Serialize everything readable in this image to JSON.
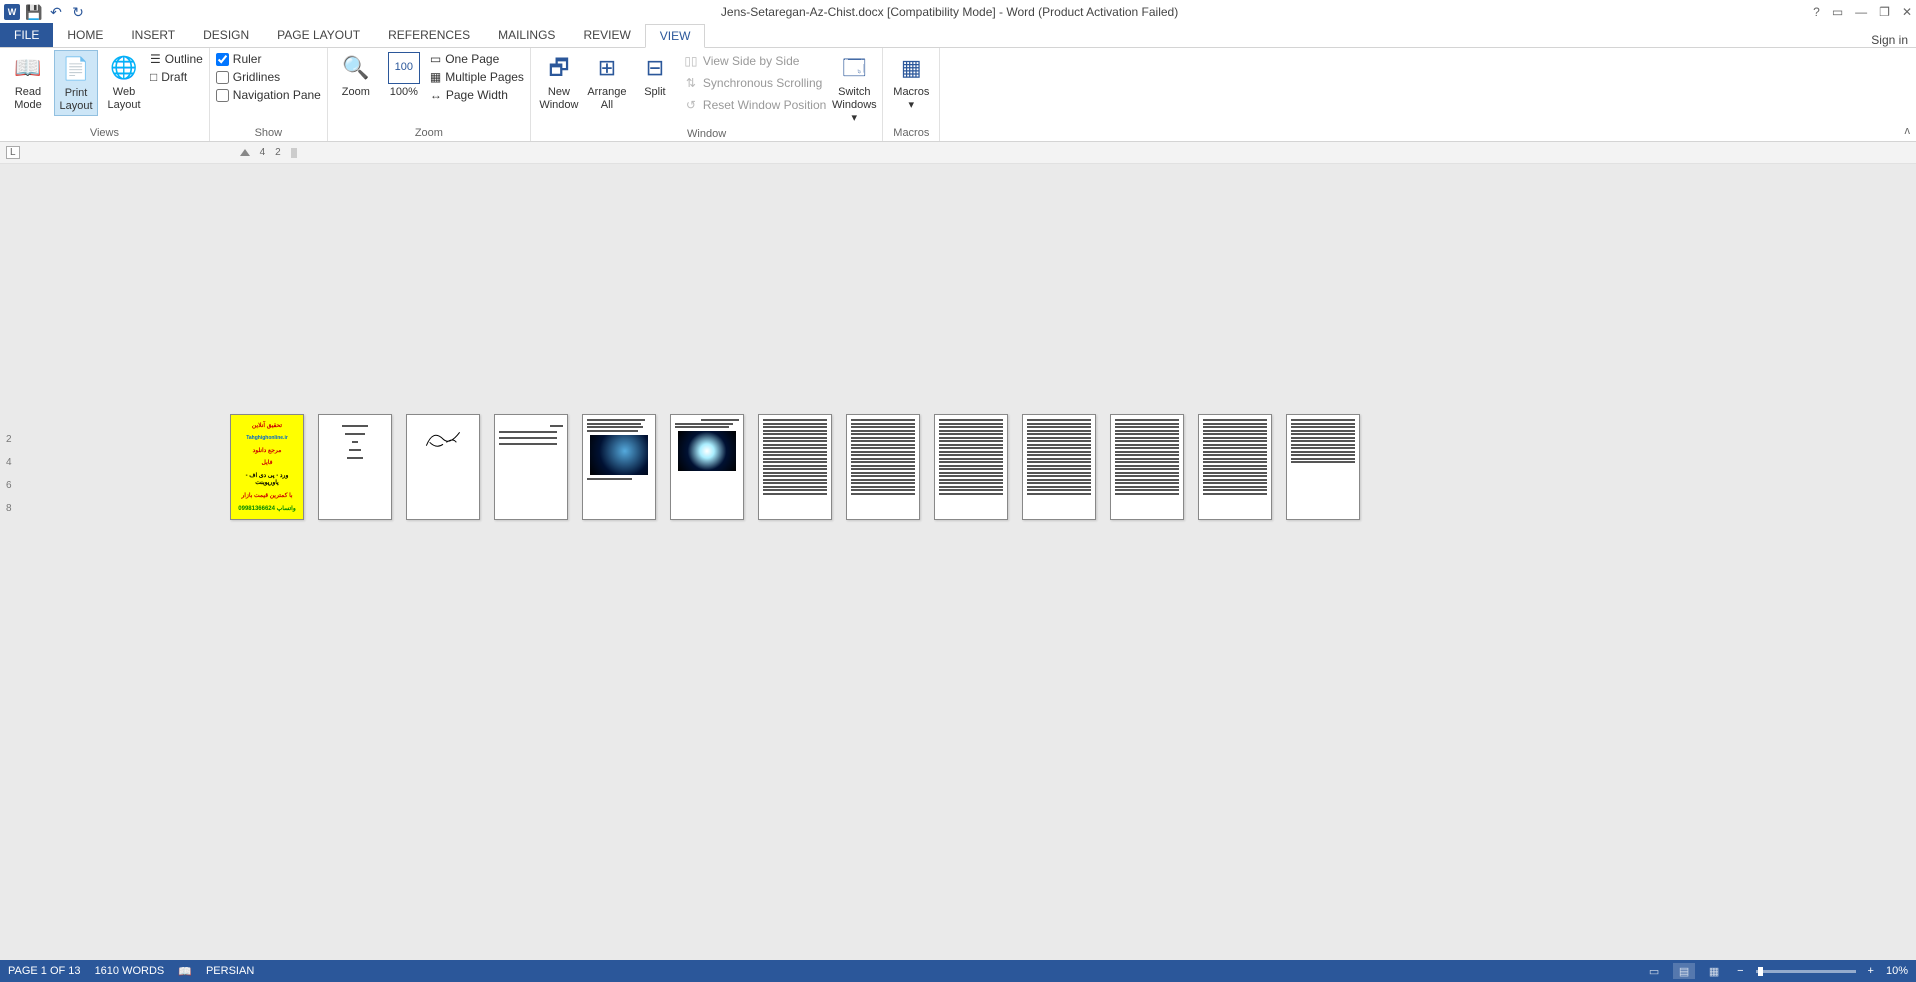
{
  "title": "Jens-Setaregan-Az-Chist.docx [Compatibility Mode] - Word (Product Activation Failed)",
  "qat": {
    "save": "💾",
    "undo": "↶",
    "redo": "↻"
  },
  "winbtns": {
    "help": "?",
    "riboptions": "▭",
    "min": "—",
    "max": "❐",
    "close": "✕"
  },
  "tabs": {
    "file": "FILE",
    "items": [
      "HOME",
      "INSERT",
      "DESIGN",
      "PAGE LAYOUT",
      "REFERENCES",
      "MAILINGS",
      "REVIEW",
      "VIEW"
    ],
    "active": "VIEW",
    "signin": "Sign in"
  },
  "ribbon": {
    "views": {
      "read": "Read Mode",
      "print": "Print Layout",
      "web": "Web Layout",
      "outline": "Outline",
      "draft": "Draft",
      "label": "Views"
    },
    "show": {
      "ruler": "Ruler",
      "gridlines": "Gridlines",
      "navpane": "Navigation Pane",
      "label": "Show"
    },
    "zoom": {
      "zoom": "Zoom",
      "hundred": "100%",
      "one": "One Page",
      "multi": "Multiple Pages",
      "width": "Page Width",
      "label": "Zoom"
    },
    "window": {
      "new": "New Window",
      "arrange": "Arrange All",
      "split": "Split",
      "side": "View Side by Side",
      "sync": "Synchronous Scrolling",
      "reset": "Reset Window Position",
      "switch": "Switch Windows",
      "label": "Window"
    },
    "macros": {
      "macros": "Macros",
      "label": "Macros"
    }
  },
  "ruler": {
    "L": "L",
    "n1": "4",
    "n2": "2"
  },
  "vruler": [
    "2",
    "4",
    "6",
    "8"
  ],
  "cover": {
    "l1": "تحقیق آنلاین",
    "l2": "Tahghighonline.ir",
    "l3": "مرجع دانلود",
    "l4": "فایل",
    "l5": "ورد - پی دی اف - پاورپوینت",
    "l6": "با کمترین قیمت بازار",
    "l7": "واتساپ 09981366624"
  },
  "status": {
    "page": "PAGE 1 OF 13",
    "words": "1610 WORDS",
    "lang": "PERSIAN",
    "zoom": "10%"
  }
}
